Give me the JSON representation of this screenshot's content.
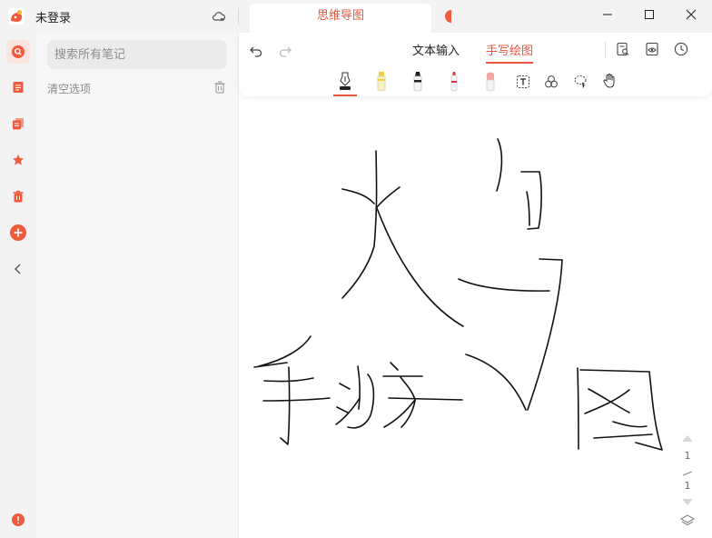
{
  "titlebar": {
    "user_status": "未登录",
    "active_tab": "思维导图"
  },
  "sidebar": {
    "items": [
      {
        "name": "search",
        "icon": "search-icon"
      },
      {
        "name": "notes",
        "icon": "note-icon"
      },
      {
        "name": "notebooks",
        "icon": "notebook-icon"
      },
      {
        "name": "favorites",
        "icon": "star-icon"
      },
      {
        "name": "trash",
        "icon": "trash-icon"
      },
      {
        "name": "new",
        "icon": "plus-circle-icon"
      },
      {
        "name": "collapse",
        "icon": "chevron-left-icon"
      },
      {
        "name": "feedback",
        "icon": "alert-icon"
      }
    ]
  },
  "list": {
    "search_placeholder": "搜索所有笔记",
    "clear_label": "清空选项"
  },
  "editor": {
    "mode_text": "文本输入",
    "mode_handwrite": "手写绘图",
    "page_current": "1",
    "page_total": "1"
  },
  "colors": {
    "accent": "#e8553d",
    "rail_bg": "#f3f3f3",
    "panel_bg": "#f7f7f7"
  }
}
